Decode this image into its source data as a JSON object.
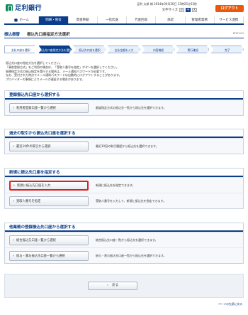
{
  "header": {
    "logo_text": "足利銀行",
    "user_info": "足利 太郎 様 2014年09月26日 13時25分03秒",
    "text_size_label": "文字サイズ",
    "text_sizes": [
      "小",
      "中",
      "大"
    ],
    "logout_label": "ログアウト"
  },
  "nav": {
    "items": [
      "ホーム",
      "明細・照会",
      "資金移動",
      "一括伝送",
      "代金回収",
      "承認",
      "管理者業務",
      "サービス連携"
    ],
    "active_index": 1
  },
  "title": {
    "category": "振込振替",
    "main": "振込先口座指定方法選択",
    "screen_id": "BFKF003"
  },
  "steps": [
    "支払口座を選択",
    "振込先口座指定方法を選択",
    "振込先口座を選択",
    "支払金額を入力",
    "内容確認",
    "実行確認",
    "完了"
  ],
  "intro": {
    "line1": "振込先口座の指定方法を選択してください。",
    "line2": "「事前登録方式」をご利用の場合は、「受取人番号を指定」ボタンを選択してください。",
    "line3": "振替指定方式の振込指定を実行する場合は、メール通知パスワードが必要です。",
    "line4": "なお、受付された時点でメール通知パスワードは自動的にログアウトすることがあります。",
    "line5": "プロバイダーの事情によりメールが遅延する場合があります。"
  },
  "sections": {
    "registered": {
      "heading": "登録振込先口座から選択する",
      "button": "利用者登録口座一覧から選択",
      "desc": "都度指定方式の振込先一覧から振込先を選択できます。"
    },
    "history": {
      "heading": "過去の取引から振込先口座を選択する",
      "button": "最近10件の取引から選択",
      "desc": "最近10回の取引履歴から振込先を選択できます。"
    },
    "new": {
      "heading": "新規に振込先口座を指定する",
      "button1": "新規に振込先口座を入力",
      "desc1": "新規に振込先を指定できます。",
      "button2": "受取人番号を指定",
      "desc2": "受取人番号を入力して、新規に振込先を指定できます。"
    },
    "other": {
      "heading": "他業務の登録振込先口座から選択する",
      "button1": "総合振込先口座一覧から選択",
      "desc1": "総合振込先口座一覧から振込先を選択できます。",
      "button2": "給与・賞与振込先口座一覧から選択",
      "desc2": "給与・賞与振込先口座一覧から振込先を選択できます。"
    }
  },
  "back_label": "戻る",
  "pagetop_label": "ページの先頭に戻る"
}
